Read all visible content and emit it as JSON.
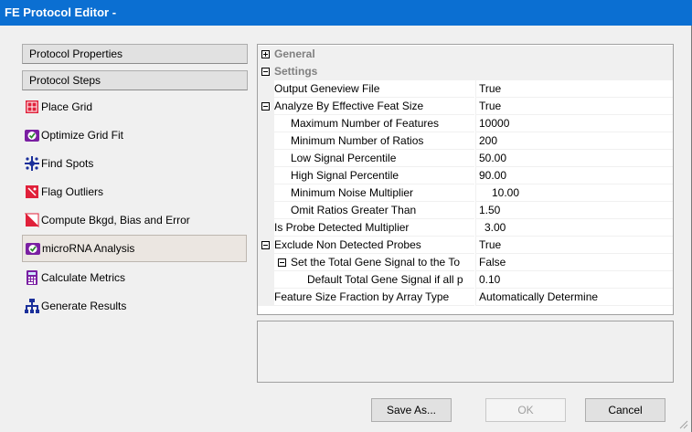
{
  "window": {
    "title": "FE Protocol Editor -"
  },
  "left_panel": {
    "protocol_properties": "Protocol Properties",
    "protocol_steps": "Protocol Steps"
  },
  "steps": [
    {
      "label": "Place Grid",
      "icon": "place-grid-icon"
    },
    {
      "label": "Optimize Grid Fit",
      "icon": "optimize-grid-fit-icon"
    },
    {
      "label": "Find Spots",
      "icon": "find-spots-icon"
    },
    {
      "label": "Flag Outliers",
      "icon": "flag-outliers-icon"
    },
    {
      "label": "Compute Bkgd, Bias and Error",
      "icon": "compute-bkgd-icon"
    },
    {
      "label": "microRNA Analysis",
      "icon": "microrna-analysis-icon",
      "selected": true
    },
    {
      "label": "Calculate Metrics",
      "icon": "calculate-metrics-icon"
    },
    {
      "label": "Generate Results",
      "icon": "generate-results-icon"
    }
  ],
  "grid": {
    "categories": {
      "general": "General",
      "settings": "Settings"
    },
    "rows": [
      {
        "name": "Output Geneview File",
        "value": "True"
      },
      {
        "name": "Analyze By Effective Feat Size",
        "value": "True"
      },
      {
        "name": "Maximum Number of Features",
        "value": "10000"
      },
      {
        "name": "Minimum Number of Ratios",
        "value": "200"
      },
      {
        "name": "Low Signal Percentile",
        "value": "50.00"
      },
      {
        "name": "High Signal Percentile",
        "value": "90.00"
      },
      {
        "name": "Minimum Noise Multiplier",
        "value": "10.00"
      },
      {
        "name": "Omit Ratios Greater Than",
        "value": "1.50"
      },
      {
        "name": "Is Probe Detected Multiplier",
        "value": "3.00"
      },
      {
        "name": "Exclude Non Detected Probes",
        "value": "True"
      },
      {
        "name": "Set the Total Gene Signal to the To",
        "value": "False"
      },
      {
        "name": "Default Total Gene Signal if all p",
        "value": "0.10"
      },
      {
        "name": "Feature Size Fraction by Array Type",
        "value": "Automatically Determine"
      }
    ]
  },
  "buttons": {
    "save_as": "Save As...",
    "ok": "OK",
    "cancel": "Cancel"
  }
}
